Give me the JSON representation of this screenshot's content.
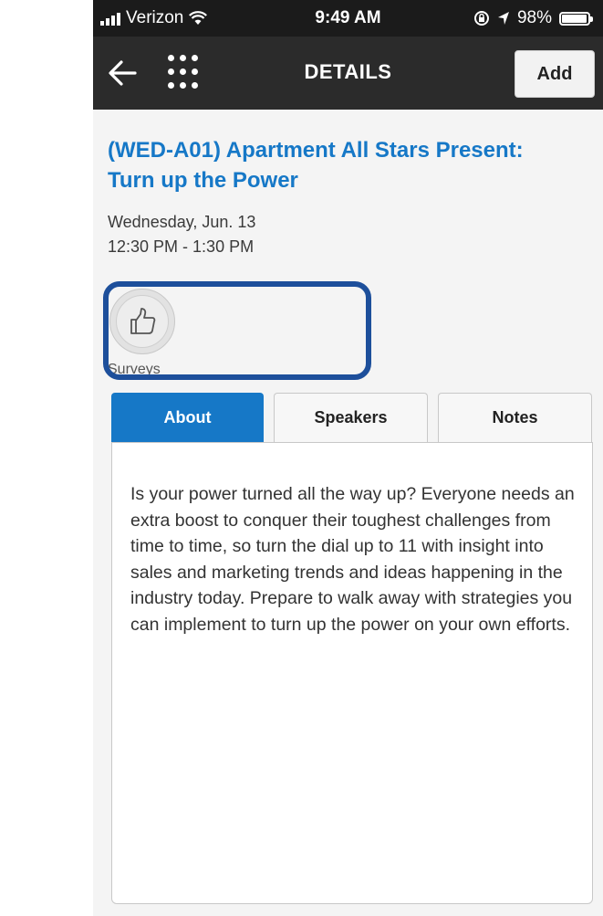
{
  "status_bar": {
    "carrier": "Verizon",
    "time": "9:49 AM",
    "battery_percent": "98%",
    "battery_level": 0.98,
    "icons": [
      "signal-bars-icon",
      "wifi-icon",
      "lock-rotation-icon",
      "location-arrow-icon",
      "battery-icon"
    ]
  },
  "nav": {
    "title": "DETAILS",
    "add_label": "Add",
    "icons": [
      "back-arrow-icon",
      "grid-menu-icon"
    ]
  },
  "session": {
    "title": "(WED-A01) Apartment All Stars Present: Turn up the Power",
    "date": "Wednesday, Jun. 13",
    "time": "12:30 PM - 1:30 PM"
  },
  "surveys": {
    "label": "Surveys",
    "icon": "thumbs-up-icon"
  },
  "tabs": [
    {
      "label": "About",
      "active": true
    },
    {
      "label": "Speakers",
      "active": false
    },
    {
      "label": "Notes",
      "active": false
    }
  ],
  "about": {
    "text": "Is your power turned all the way up? Everyone needs an extra boost to conquer their toughest challenges from time to time, so turn the dial up to 11 with insight into sales and marketing trends and ideas happening in the industry today. Prepare to walk away with strategies you can implement to turn up the power on your own efforts."
  },
  "colors": {
    "accent_blue": "#1678c7",
    "highlight_border": "#1d4f9b",
    "status_bar_bg": "#1b1b1b",
    "nav_bg": "#2b2b2b"
  }
}
